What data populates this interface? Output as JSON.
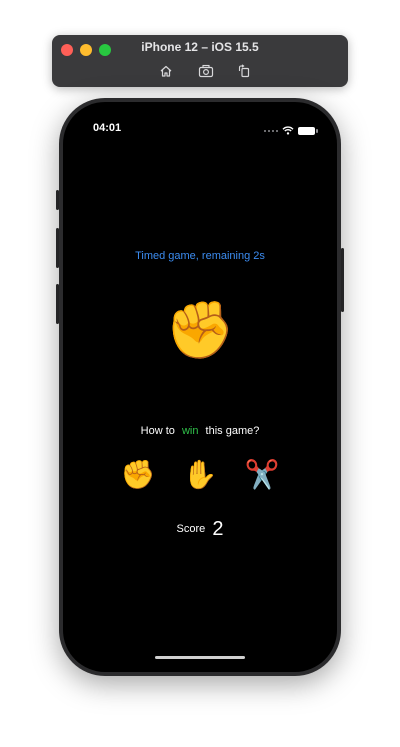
{
  "simulator": {
    "title": "iPhone 12 – iOS 15.5",
    "icons": [
      "home-icon",
      "screenshot-icon",
      "rotate-icon"
    ]
  },
  "status_bar": {
    "time": "04:01",
    "icons": [
      "cellular-signal-icon",
      "wifi-icon",
      "battery-icon"
    ]
  },
  "game": {
    "timer_text": "Timed game, remaining 2s",
    "current_move": "✊",
    "question": {
      "prefix": "How to",
      "goal": "win",
      "suffix": "this game?"
    },
    "choices": [
      {
        "name": "rock",
        "emoji": "✊"
      },
      {
        "name": "paper",
        "emoji": "✋"
      },
      {
        "name": "scissors",
        "emoji": "✂️"
      }
    ],
    "score_label": "Score",
    "score_value": "2"
  },
  "colors": {
    "timer_text": "#3c8cf0",
    "goal_word": "#30c04a",
    "screen_bg": "#000000"
  }
}
